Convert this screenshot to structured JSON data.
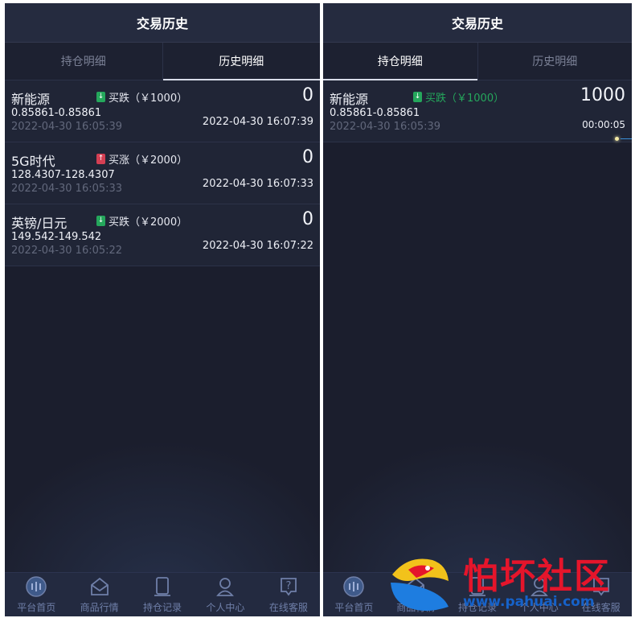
{
  "left": {
    "title": "交易历史",
    "tabs": [
      {
        "label": "持仓明细",
        "active": false
      },
      {
        "label": "历史明细",
        "active": true
      }
    ],
    "rows": [
      {
        "name": "新能源",
        "direction": "down",
        "trade_label": "买跌（￥1000）",
        "range": "0.85861-0.85861",
        "open_time": "2022-04-30 16:05:39",
        "profit": "0",
        "close_time": "2022-04-30 16:07:39"
      },
      {
        "name": "5G时代",
        "direction": "up",
        "trade_label": "买涨（￥2000）",
        "range": "128.4307-128.4307",
        "open_time": "2022-04-30 16:05:33",
        "profit": "0",
        "close_time": "2022-04-30 16:07:33"
      },
      {
        "name": "英镑/日元",
        "direction": "down",
        "trade_label": "买跌（￥2000）",
        "range": "149.542-149.542",
        "open_time": "2022-04-30 16:05:22",
        "profit": "0",
        "close_time": "2022-04-30 16:07:22"
      }
    ]
  },
  "right": {
    "title": "交易历史",
    "tabs": [
      {
        "label": "持仓明细",
        "active": true
      },
      {
        "label": "历史明细",
        "active": false
      }
    ],
    "rows": [
      {
        "name": "新能源",
        "direction": "down",
        "trade_label": "买跌（￥1000）",
        "range": "0.85861-0.85861",
        "open_time": "2022-04-30 16:05:39",
        "profit": "1000",
        "countdown": "00:00:05"
      }
    ]
  },
  "nav": [
    {
      "label": "平台首页",
      "icon": "platform-logo-icon"
    },
    {
      "label": "商品行情",
      "icon": "market-envelope-icon"
    },
    {
      "label": "持仓记录",
      "icon": "record-icon"
    },
    {
      "label": "个人中心",
      "icon": "user-icon"
    },
    {
      "label": "在线客服",
      "icon": "help-icon"
    }
  ],
  "watermark": {
    "title": "怕坏社区",
    "url": "www.pahuai.com"
  },
  "colors": {
    "background": "#1b1e2d",
    "header": "#252b3f",
    "down": "#25a75c",
    "up": "#d43f53",
    "nav_text": "#6f7fa8"
  }
}
